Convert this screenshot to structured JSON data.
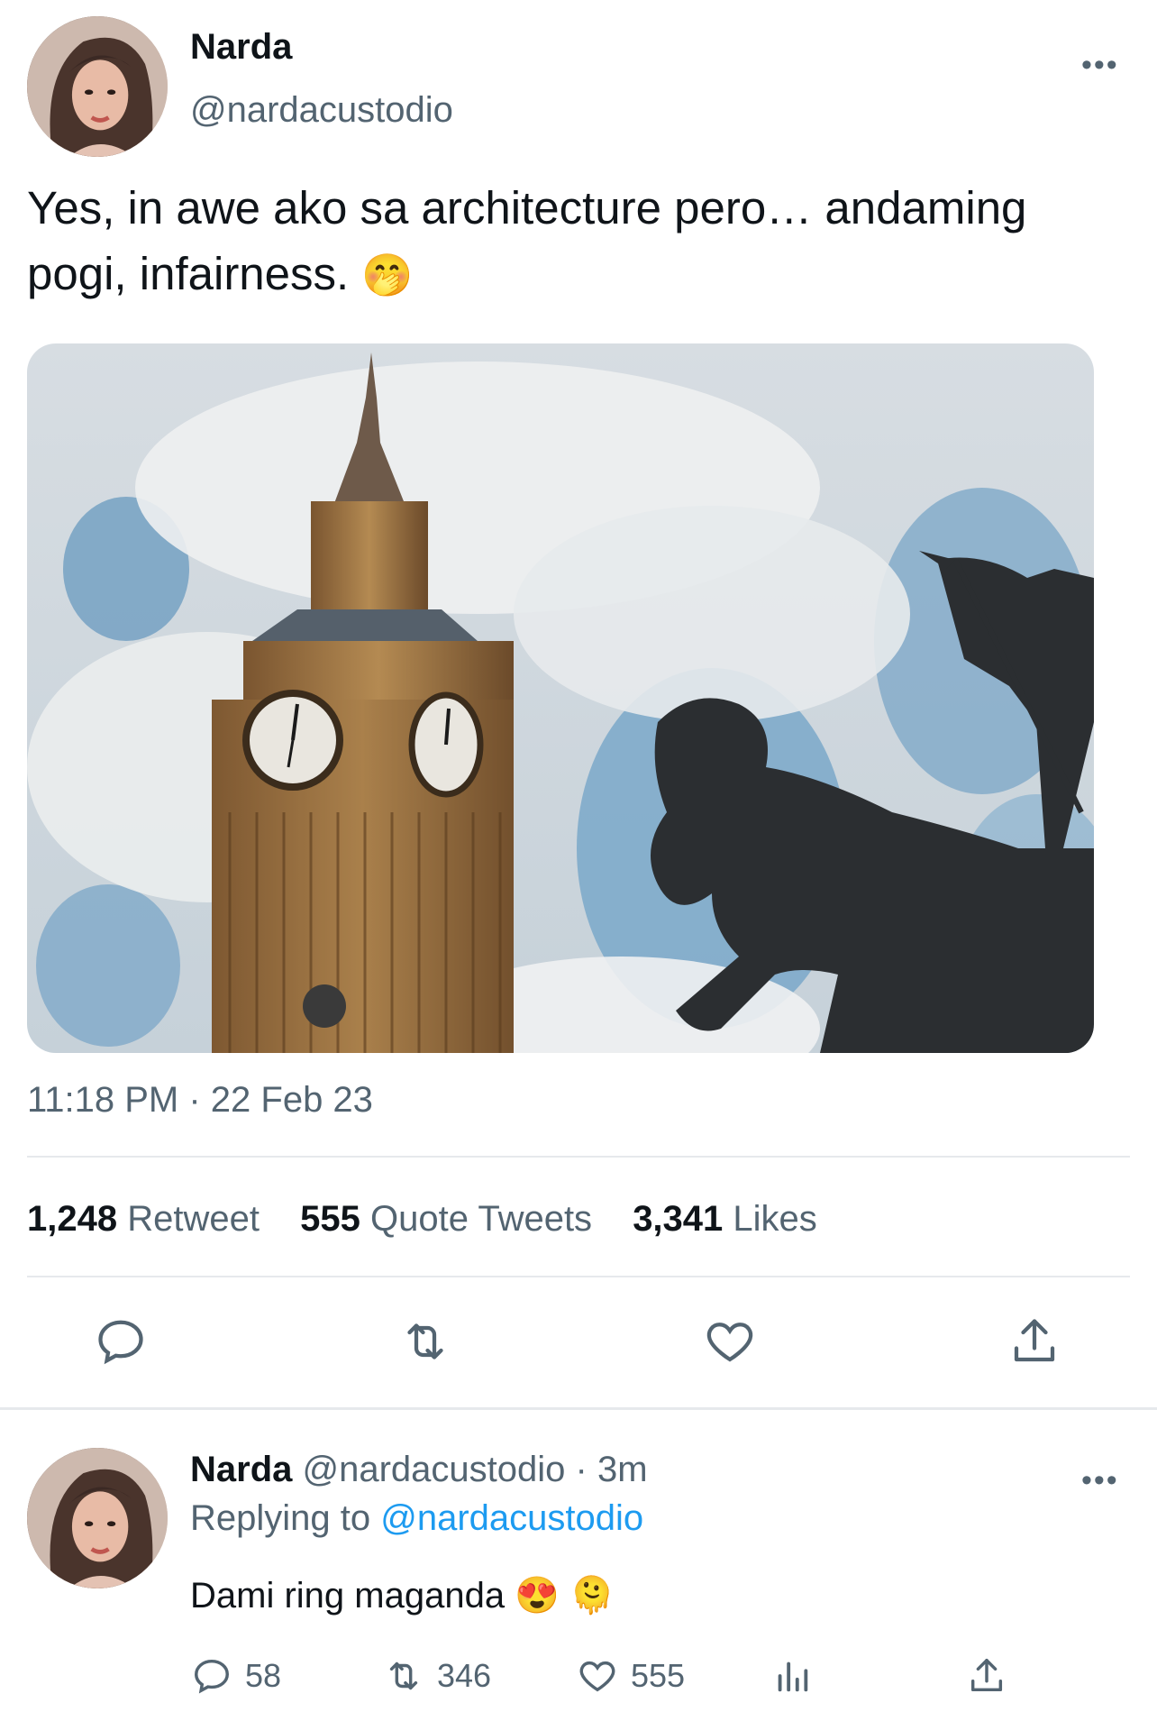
{
  "tweet": {
    "author_name": "Narda",
    "author_handle": "@nardacustodio",
    "more_label": "•••",
    "text": "Yes, in awe ako sa architecture pero… andaming pogi, infairness.",
    "emoji": "🤭",
    "timestamp": "11:18 PM · 22 Feb 23",
    "stats": {
      "retweets_count": "1,248",
      "retweets_label": "Retweet",
      "quotes_count": "555",
      "quotes_label": "Quote Tweets",
      "likes_count": "3,341",
      "likes_label": "Likes"
    },
    "actions": [
      "reply-icon",
      "retweet-icon",
      "like-icon",
      "share-icon"
    ]
  },
  "reply": {
    "author_name": "Narda",
    "author_handle": "@nardacustodio",
    "time": "· 3m",
    "more_label": "•••",
    "replying_prefix": "Replying to",
    "replying_to": "@nardacustodio",
    "text": "Dami ring maganda",
    "emoji_1": "😍",
    "emoji_2": "🫠",
    "replies": "58",
    "retweets": "346",
    "likes": "555"
  },
  "colors": {
    "accent": "#1d9bf0",
    "secondary_text": "#536471",
    "divider": "#e6e9ec"
  }
}
